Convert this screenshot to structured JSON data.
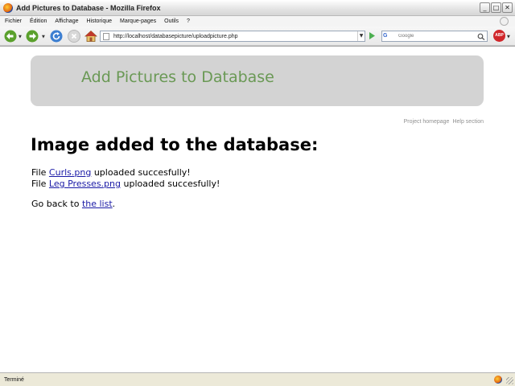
{
  "window": {
    "title": "Add Pictures to Database - Mozilla Firefox",
    "minimize_glyph": "_",
    "maximize_glyph": "□",
    "close_glyph": "✕"
  },
  "menubar": {
    "items": [
      "Fichier",
      "Édition",
      "Affichage",
      "Historique",
      "Marque-pages",
      "Outils",
      "?"
    ]
  },
  "toolbar": {
    "url": "http://localhost/databasepicture/uploadpicture.php",
    "search_engine": "G",
    "search_placeholder": "Google",
    "adblock_label": "ABP"
  },
  "page": {
    "header_title": "Add Pictures to Database",
    "links": [
      "Project homepage",
      "Help section"
    ],
    "heading": "Image added to the database:",
    "file_prefix": "File",
    "uploads": [
      {
        "filename": "Curls.png",
        "suffix": "uploaded succesfully!"
      },
      {
        "filename": "Leg Presses.png",
        "suffix": "uploaded succesfully!"
      }
    ],
    "go_back_prefix": "Go back to",
    "go_back_link": "the list",
    "go_back_suffix": "."
  },
  "statusbar": {
    "text": "Terminé"
  },
  "colors": {
    "header_bg": "#d3d3d3",
    "header_title": "#6a9955",
    "link": "#1a1aa6",
    "small_links": "#909090"
  },
  "icons": [
    "firefox-icon",
    "back-arrow-icon",
    "forward-arrow-icon",
    "reload-icon",
    "stop-icon",
    "home-icon",
    "page-icon",
    "go-arrow-icon",
    "search-icon",
    "adblock-icon"
  ]
}
